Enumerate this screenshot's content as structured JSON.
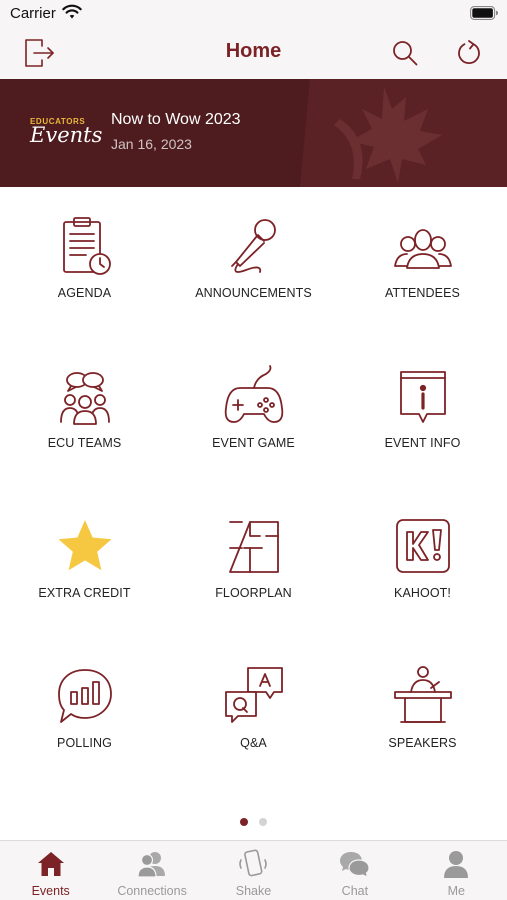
{
  "status_bar": {
    "carrier": "Carrier",
    "icons": [
      "wifi-icon",
      "battery-icon"
    ]
  },
  "nav": {
    "title": "Home",
    "left_icon": "logout-icon",
    "right_icons": [
      "search-icon",
      "refresh-icon"
    ]
  },
  "banner": {
    "logo_top": "EDUCATORS",
    "logo_script": "Events",
    "event_title": "Now to Wow 2023",
    "event_date": "Jan 16, 2023"
  },
  "grid": [
    {
      "label": "AGENDA",
      "icon": "agenda-clipboard-icon"
    },
    {
      "label": "ANNOUNCEMENTS",
      "icon": "microphone-icon"
    },
    {
      "label": "ATTENDEES",
      "icon": "people-group-icon"
    },
    {
      "label": "ECU TEAMS",
      "icon": "teams-chat-icon"
    },
    {
      "label": "EVENT GAME",
      "icon": "gamepad-icon"
    },
    {
      "label": "EVENT INFO",
      "icon": "info-sign-icon"
    },
    {
      "label": "EXTRA CREDIT",
      "icon": "star-icon"
    },
    {
      "label": "FLOORPLAN",
      "icon": "floorplan-icon"
    },
    {
      "label": "KAHOOT!",
      "icon": "kahoot-icon"
    },
    {
      "label": "POLLING",
      "icon": "poll-chart-bubble-icon"
    },
    {
      "label": "Q&A",
      "icon": "qa-bubbles-icon"
    },
    {
      "label": "SPEAKERS",
      "icon": "speaker-podium-icon"
    }
  ],
  "pager": {
    "pages": 2,
    "current": 1
  },
  "tabs": [
    {
      "label": "Events",
      "icon": "home-icon",
      "active": true
    },
    {
      "label": "Connections",
      "icon": "connections-icon",
      "active": false
    },
    {
      "label": "Shake",
      "icon": "shake-phone-icon",
      "active": false
    },
    {
      "label": "Chat",
      "icon": "chat-bubbles-icon",
      "active": false
    },
    {
      "label": "Me",
      "icon": "person-icon",
      "active": false
    }
  ],
  "colors": {
    "accent": "#7c2327",
    "banner_bg": "#4e1c1e",
    "star": "#f6c842",
    "tab_inactive": "#9a9a9a"
  }
}
